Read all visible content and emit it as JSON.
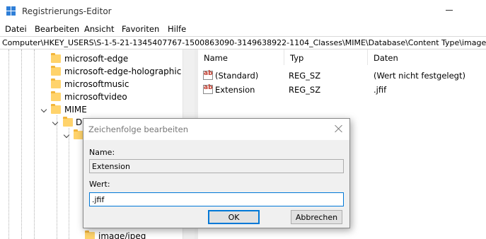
{
  "window": {
    "title": "Registrierungs-Editor"
  },
  "menu": [
    "Datei",
    "Bearbeiten",
    "Ansicht",
    "Favoriten",
    "Hilfe"
  ],
  "address": "Computer\\HKEY_USERS\\S-1-5-21-1345407767-1500863090-3149638922-1104_Classes\\MIME\\Database\\Content Type\\image/jpeg",
  "tree": {
    "items": [
      {
        "label": "microsoft-edge"
      },
      {
        "label": "microsoft-edge-holographic"
      },
      {
        "label": "microsoftmusic"
      },
      {
        "label": "microsoftvideo"
      },
      {
        "label": "MIME"
      },
      {
        "label": "Da"
      },
      {
        "label": ""
      },
      {
        "label": "image/jpeg"
      }
    ]
  },
  "values_pane": {
    "columns": [
      "Name",
      "Typ",
      "Daten"
    ],
    "rows": [
      {
        "name": "(Standard)",
        "type": "REG_SZ",
        "data": "(Wert nicht festgelegt)"
      },
      {
        "name": "Extension",
        "type": "REG_SZ",
        "data": ".jfif"
      }
    ]
  },
  "dialog": {
    "title": "Zeichenfolge bearbeiten",
    "name_label": "Name:",
    "name_value": "Extension",
    "value_label": "Wert:",
    "value_value": ".jfif",
    "ok_label": "OK",
    "cancel_label": "Abbrechen"
  },
  "colors": {
    "accent": "#0078d7",
    "folder": "#ffd36b",
    "dialog_bg": "#f0f0f0",
    "icon_text": "#c0392b"
  }
}
